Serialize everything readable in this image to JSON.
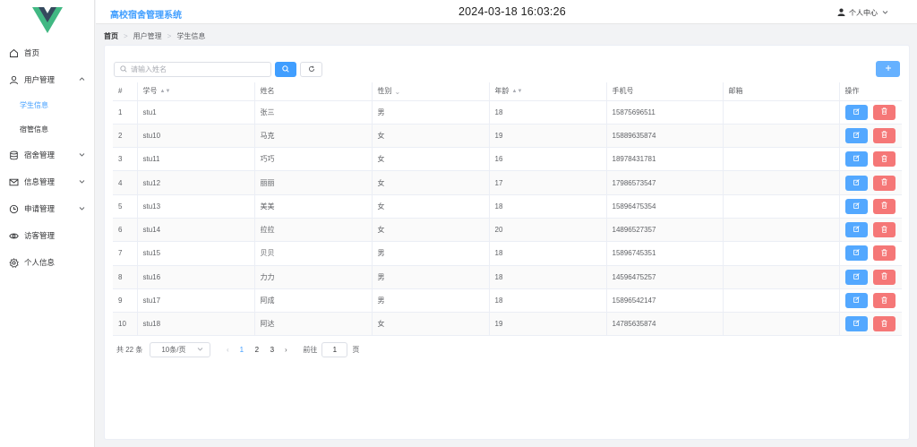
{
  "app": {
    "title": "高校宿舍管理系统",
    "datetime": "2024-03-18 16:03:26"
  },
  "user_menu": {
    "label": "个人中心"
  },
  "sidebar": {
    "items": [
      {
        "label": "首页",
        "icon": "home-icon"
      },
      {
        "label": "用户管理",
        "icon": "user-icon",
        "expanded": true,
        "children": [
          {
            "label": "学生信息",
            "active": true
          },
          {
            "label": "宿管信息",
            "active": false
          }
        ]
      },
      {
        "label": "宿舍管理",
        "icon": "database-icon"
      },
      {
        "label": "信息管理",
        "icon": "message-icon"
      },
      {
        "label": "申请管理",
        "icon": "clock-icon"
      },
      {
        "label": "访客管理",
        "icon": "eye-icon"
      },
      {
        "label": "个人信息",
        "icon": "gear-icon"
      }
    ]
  },
  "breadcrumb": {
    "home": "首页",
    "level1": "用户管理",
    "level2": "学生信息"
  },
  "search": {
    "placeholder": "请输入姓名",
    "value": ""
  },
  "table": {
    "headers": {
      "index": "#",
      "student_id": "学号",
      "name": "姓名",
      "gender": "性别",
      "age": "年龄",
      "phone": "手机号",
      "email": "邮箱",
      "actions": "操作"
    },
    "rows": [
      {
        "index": "1",
        "student_id": "stu1",
        "name": "张三",
        "gender": "男",
        "age": "18",
        "phone": "15875696511",
        "email": ""
      },
      {
        "index": "2",
        "student_id": "stu10",
        "name": "马克",
        "gender": "女",
        "age": "19",
        "phone": "15889635874",
        "email": ""
      },
      {
        "index": "3",
        "student_id": "stu11",
        "name": "巧巧",
        "gender": "女",
        "age": "16",
        "phone": "18978431781",
        "email": ""
      },
      {
        "index": "4",
        "student_id": "stu12",
        "name": "丽丽",
        "gender": "女",
        "age": "17",
        "phone": "17986573547",
        "email": ""
      },
      {
        "index": "5",
        "student_id": "stu13",
        "name": "美美",
        "gender": "女",
        "age": "18",
        "phone": "15896475354",
        "email": ""
      },
      {
        "index": "6",
        "student_id": "stu14",
        "name": "拉拉",
        "gender": "女",
        "age": "20",
        "phone": "14896527357",
        "email": ""
      },
      {
        "index": "7",
        "student_id": "stu15",
        "name": "贝贝",
        "gender": "男",
        "age": "18",
        "phone": "15896745351",
        "email": ""
      },
      {
        "index": "8",
        "student_id": "stu16",
        "name": "力力",
        "gender": "男",
        "age": "18",
        "phone": "14596475257",
        "email": ""
      },
      {
        "index": "9",
        "student_id": "stu17",
        "name": "阿成",
        "gender": "男",
        "age": "18",
        "phone": "15896542147",
        "email": ""
      },
      {
        "index": "10",
        "student_id": "stu18",
        "name": "阿达",
        "gender": "女",
        "age": "19",
        "phone": "14785635874",
        "email": ""
      }
    ]
  },
  "pagination": {
    "total_text": "共 22 条",
    "page_size": "10条/页",
    "pages": [
      "1",
      "2",
      "3"
    ],
    "current": "1",
    "goto_prefix": "前往",
    "goto_value": "1",
    "goto_suffix": "页"
  },
  "colors": {
    "primary": "#409eff",
    "danger": "#f56c6c",
    "logo_green": "#41b883",
    "logo_dark": "#35495e"
  }
}
